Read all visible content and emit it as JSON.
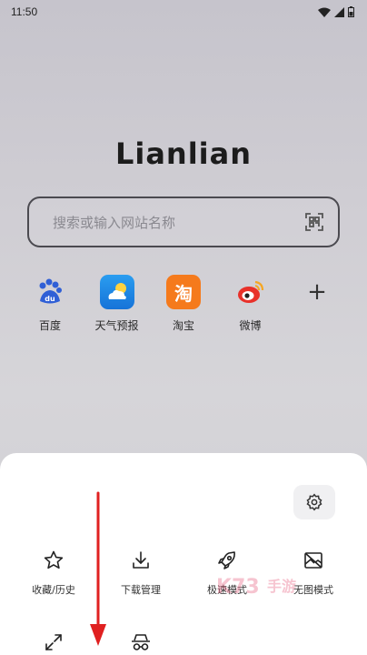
{
  "status_bar": {
    "time": "11:50",
    "wifi_icon": "wifi-icon",
    "signal_icon": "signal-icon",
    "battery_icon": "battery-icon"
  },
  "logo": "Lianlian",
  "search": {
    "placeholder": "搜索或输入网站名称",
    "scan_icon": "qr-scan-icon"
  },
  "shortcuts": [
    {
      "label": "百度",
      "icon": "baidu-icon",
      "color": "#2f5fd6"
    },
    {
      "label": "天气预报",
      "icon": "weather-icon",
      "color": "#1f8fe8"
    },
    {
      "label": "淘宝",
      "icon": "taobao-icon",
      "color": "#f57a1c",
      "glyph": "淘"
    },
    {
      "label": "微博",
      "icon": "weibo-icon",
      "color": "#e8312a"
    },
    {
      "label": "",
      "icon": "plus-icon",
      "glyph": "+"
    }
  ],
  "sheet": {
    "settings_icon": "gear-icon",
    "menu": [
      {
        "label": "收藏/历史",
        "icon": "star-icon"
      },
      {
        "label": "下载管理",
        "icon": "download-icon"
      },
      {
        "label": "极速模式",
        "icon": "rocket-icon"
      },
      {
        "label": "无图模式",
        "icon": "no-image-icon"
      },
      {
        "label": "",
        "icon": "fullscreen-icon"
      },
      {
        "label": "",
        "icon": "incognito-icon"
      }
    ]
  },
  "annotation": {
    "arrow_color": "#e02020"
  },
  "watermark": {
    "text": "K73 手游"
  }
}
